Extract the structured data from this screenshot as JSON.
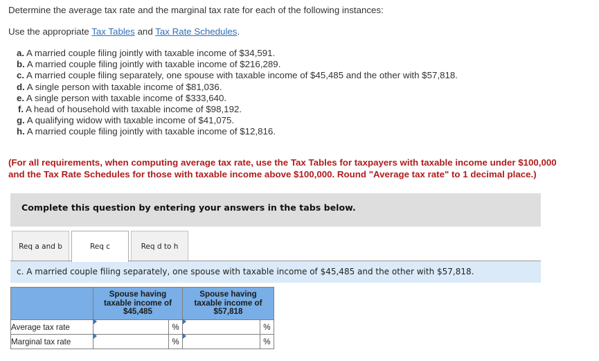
{
  "question": {
    "intro": "Determine the average tax rate and the marginal tax rate for each of the following instances:",
    "use_prefix": "Use the appropriate ",
    "link_tax_tables": "Tax Tables",
    "use_middle": " and ",
    "link_tax_rate_schedules": "Tax Rate Schedules",
    "use_suffix": ".",
    "items": [
      {
        "letter": "a.",
        "text": " A married couple filing jointly with taxable income of $34,591."
      },
      {
        "letter": "b.",
        "text": " A married couple filing jointly with taxable income of $216,289."
      },
      {
        "letter": "c.",
        "text": " A married couple filing separately, one spouse with taxable income of $45,485 and the other with $57,818."
      },
      {
        "letter": "d.",
        "text": " A single person with taxable income of $81,036."
      },
      {
        "letter": "e.",
        "text": " A single person with taxable income of $333,640."
      },
      {
        "letter": "f.",
        "text": " A head of household with taxable income of $98,192."
      },
      {
        "letter": "g.",
        "text": " A qualifying widow with taxable income of $41,075."
      },
      {
        "letter": "h.",
        "text": " A married couple filing jointly with taxable income of $12,816."
      }
    ],
    "note_line1": "(For all requirements, when computing average tax rate, use the Tax Tables for taxpayers with taxable income under $100,000",
    "note_line2": "and the Tax Rate Schedules for those with taxable income above $100,000. Round \"Average tax rate\" to 1 decimal place.)"
  },
  "panel": {
    "instruction": "Complete this question by entering your answers in the tabs below."
  },
  "tabs": [
    {
      "label": "Req a and b",
      "active": false
    },
    {
      "label": "Req c",
      "active": true
    },
    {
      "label": "Req d to h",
      "active": false
    }
  ],
  "infobar": {
    "text": "c. A married couple filing separately, one spouse with taxable income of $45,485 and the other with $57,818."
  },
  "table": {
    "headers": [
      {
        "line1": "Spouse having",
        "line2": "taxable income of",
        "line3": "$45,485"
      },
      {
        "line1": "Spouse having",
        "line2": "taxable income of",
        "line3": "$57,818"
      }
    ],
    "rows": [
      {
        "label": "Average tax rate",
        "values": [
          "",
          ""
        ],
        "unit": "%"
      },
      {
        "label": "Marginal tax rate",
        "values": [
          "",
          ""
        ],
        "unit": "%"
      }
    ]
  }
}
